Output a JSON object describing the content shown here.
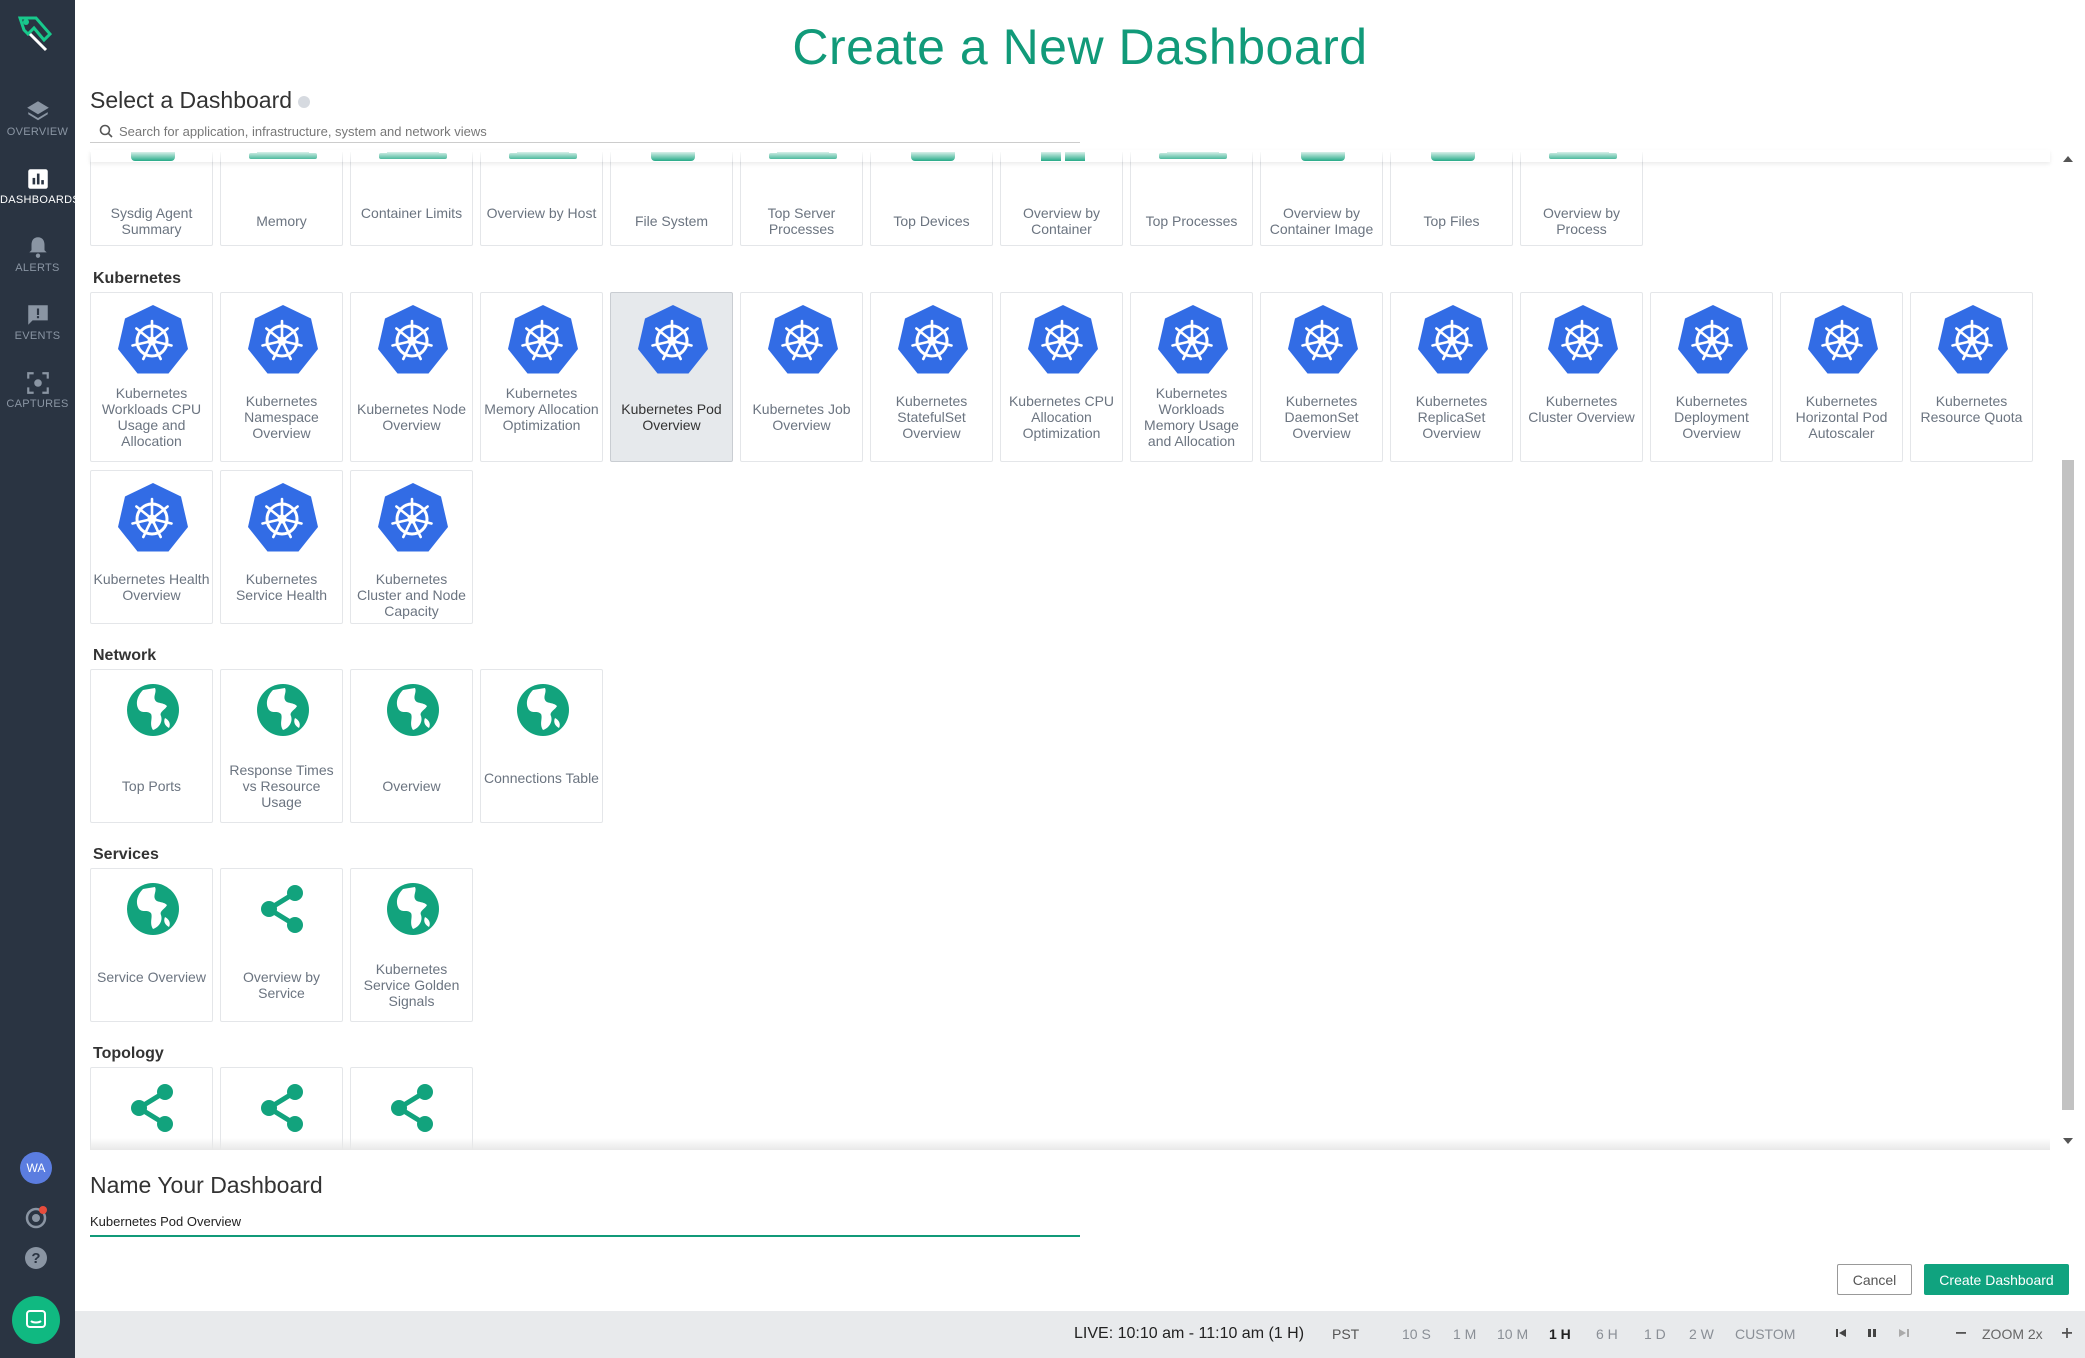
{
  "colors": {
    "accent": "#119a79",
    "sidebar": "#2a3442",
    "kubernetes_blue": "#326ce5",
    "tile_icon_green": "#12a37d"
  },
  "sidebar": {
    "logo": "sysdig-logo-icon",
    "items": [
      {
        "label": "OVERVIEW",
        "icon": "layers-icon"
      },
      {
        "label": "DASHBOARDS",
        "icon": "bar-chart-icon"
      },
      {
        "label": "ALERTS",
        "icon": "bell-icon"
      },
      {
        "label": "EVENTS",
        "icon": "message-icon"
      },
      {
        "label": "CAPTURES",
        "icon": "capture-icon"
      }
    ],
    "avatar_initials": "WA"
  },
  "page": {
    "title": "Create a New Dashboard",
    "select_title": "Select a Dashboard",
    "search_placeholder": "Search for application, infrastructure, system and network views"
  },
  "sections": {
    "host": {
      "tiles": [
        "Sysdig Agent Summary",
        "Memory",
        "Container Limits",
        "Overview by Host",
        "File System",
        "Top Server Processes",
        "Top Devices",
        "Overview by Container",
        "Top Processes",
        "Overview by Container Image",
        "Top Files",
        "Overview by Process"
      ]
    },
    "kubernetes": {
      "title": "Kubernetes",
      "tiles": [
        "Kubernetes Workloads CPU Usage and Allocation",
        "Kubernetes Namespace Overview",
        "Kubernetes Node Overview",
        "Kubernetes Memory Allocation Optimization",
        "Kubernetes Pod Overview",
        "Kubernetes Job Overview",
        "Kubernetes StatefulSet Overview",
        "Kubernetes CPU Allocation Optimization",
        "Kubernetes Workloads Memory Usage and Allocation",
        "Kubernetes DaemonSet Overview",
        "Kubernetes ReplicaSet Overview",
        "Kubernetes Cluster Overview",
        "Kubernetes Deployment Overview",
        "Kubernetes Horizontal Pod Autoscaler",
        "Kubernetes Resource Quota",
        "Kubernetes Health Overview",
        "Kubernetes Service Health",
        "Kubernetes Cluster and Node Capacity"
      ],
      "selected": "Kubernetes Pod Overview"
    },
    "network": {
      "title": "Network",
      "tiles": [
        "Top Ports",
        "Response Times vs Resource Usage",
        "Overview",
        "Connections Table"
      ]
    },
    "services": {
      "title": "Services",
      "tiles": [
        "Service Overview",
        "Overview by Service",
        "Kubernetes Service Golden Signals"
      ]
    },
    "topology": {
      "title": "Topology",
      "tiles": [
        "",
        "",
        ""
      ]
    }
  },
  "name": {
    "title": "Name Your Dashboard",
    "value": "Kubernetes Pod Overview"
  },
  "buttons": {
    "cancel": "Cancel",
    "create": "Create Dashboard"
  },
  "timebar": {
    "live": "LIVE: 10:10 am - 11:10 am (1 H)",
    "timezone": "PST",
    "ranges": [
      "10 S",
      "1 M",
      "10 M",
      "1 H",
      "6 H",
      "1 D",
      "2 W",
      "CUSTOM"
    ],
    "active_range": "1 H",
    "zoom": "ZOOM 2x"
  }
}
